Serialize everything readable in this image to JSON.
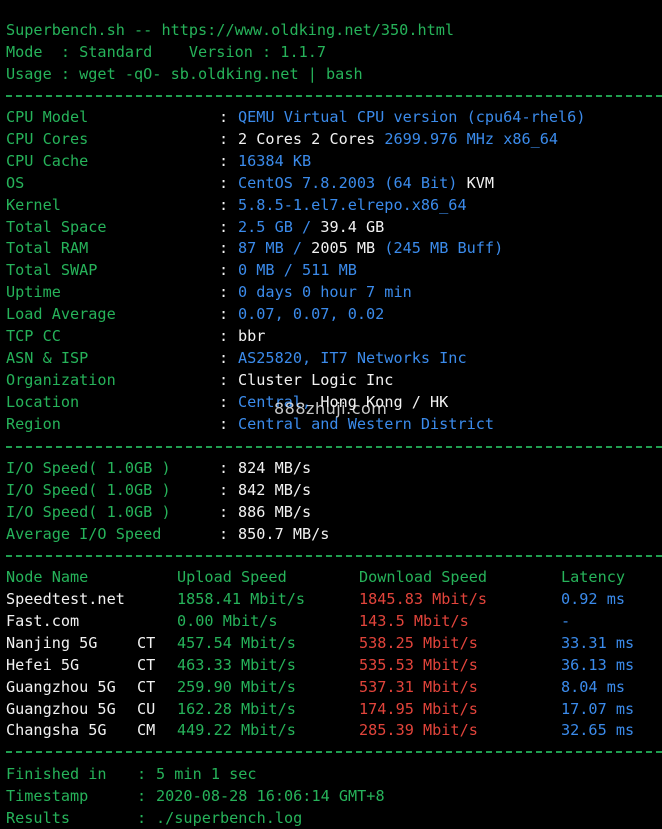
{
  "header": {
    "title": "Superbench.sh -- https://www.oldking.net/350.html",
    "mode_line": "Mode  : Standard    Version : 1.1.7",
    "usage_line": "Usage : wget -qO- sb.oldking.net | bash"
  },
  "sysinfo": [
    {
      "label": "CPU Model",
      "value": "QEMU Virtual CPU version (cpu64-rhel6)"
    },
    {
      "label": "CPU Cores",
      "value_w": "2 Cores",
      "value_c": "2699.976 MHz x86_64"
    },
    {
      "label": "CPU Cache",
      "value": "16384 KB"
    },
    {
      "label": "OS",
      "value": "CentOS 7.8.2003 (64 Bit)",
      "value_w": "KVM"
    },
    {
      "label": "Kernel",
      "value": "5.8.5-1.el7.elrepo.x86_64"
    },
    {
      "label": "Total Space",
      "value": "2.5 GB /",
      "value_w": "39.4 GB"
    },
    {
      "label": "Total RAM",
      "value": "87 MB /",
      "value_w": "2005 MB",
      "value_c2": "(245 MB Buff)"
    },
    {
      "label": "Total SWAP",
      "value": "0 MB / 511 MB"
    },
    {
      "label": "Uptime",
      "value": "0 days 0 hour 7 min"
    },
    {
      "label": "Load Average",
      "value": "0.07, 0.07, 0.02"
    },
    {
      "label": "TCP CC",
      "value_w": "bbr"
    },
    {
      "label": "ASN & ISP",
      "value": "AS25820, IT7 Networks Inc"
    },
    {
      "label": "Organization",
      "value_w": "Cluster Logic Inc"
    },
    {
      "label": "Location",
      "value": "Central,",
      "value_w": "Hong Kong / HK"
    },
    {
      "label": "Region",
      "value": "Central and Western District"
    }
  ],
  "io": [
    {
      "label": "I/O Speed( 1.0GB )",
      "value": "824 MB/s"
    },
    {
      "label": "I/O Speed( 1.0GB )",
      "value": "842 MB/s"
    },
    {
      "label": "I/O Speed( 1.0GB )",
      "value": "886 MB/s"
    },
    {
      "label": "Average I/O Speed",
      "value": "850.7 MB/s"
    }
  ],
  "speed_header": {
    "node": "Node Name",
    "upload": "Upload Speed",
    "download": "Download Speed",
    "latency": "Latency"
  },
  "speed_rows": [
    {
      "node": "Speedtest.net",
      "isp": "",
      "upload": "1858.41 Mbit/s",
      "download": "1845.83 Mbit/s",
      "latency": "0.92 ms"
    },
    {
      "node": "Fast.com",
      "isp": "",
      "upload": "0.00 Mbit/s",
      "download": "143.5 Mbit/s",
      "latency": "-"
    },
    {
      "node": "Nanjing 5G",
      "isp": "CT",
      "upload": "457.54 Mbit/s",
      "download": "538.25 Mbit/s",
      "latency": "33.31 ms"
    },
    {
      "node": "Hefei 5G",
      "isp": "CT",
      "upload": "463.33 Mbit/s",
      "download": "535.53 Mbit/s",
      "latency": "36.13 ms"
    },
    {
      "node": "Guangzhou 5G",
      "isp": "CT",
      "upload": "259.90 Mbit/s",
      "download": "537.31 Mbit/s",
      "latency": "8.04 ms"
    },
    {
      "node": "Guangzhou 5G",
      "isp": "CU",
      "upload": "162.28 Mbit/s",
      "download": "174.95 Mbit/s",
      "latency": "17.07 ms"
    },
    {
      "node": "Changsha 5G",
      "isp": "CM",
      "upload": "449.22 Mbit/s",
      "download": "285.39 Mbit/s",
      "latency": "32.65 ms"
    }
  ],
  "footer": [
    {
      "label": "Finished in",
      "value": "5 min 1 sec"
    },
    {
      "label": "Timestamp",
      "value": "2020-08-28 16:06:14 GMT+8"
    },
    {
      "label": "Results",
      "value": "./superbench.log"
    }
  ],
  "watermark": "888zhuji.com",
  "separator_char": ":"
}
